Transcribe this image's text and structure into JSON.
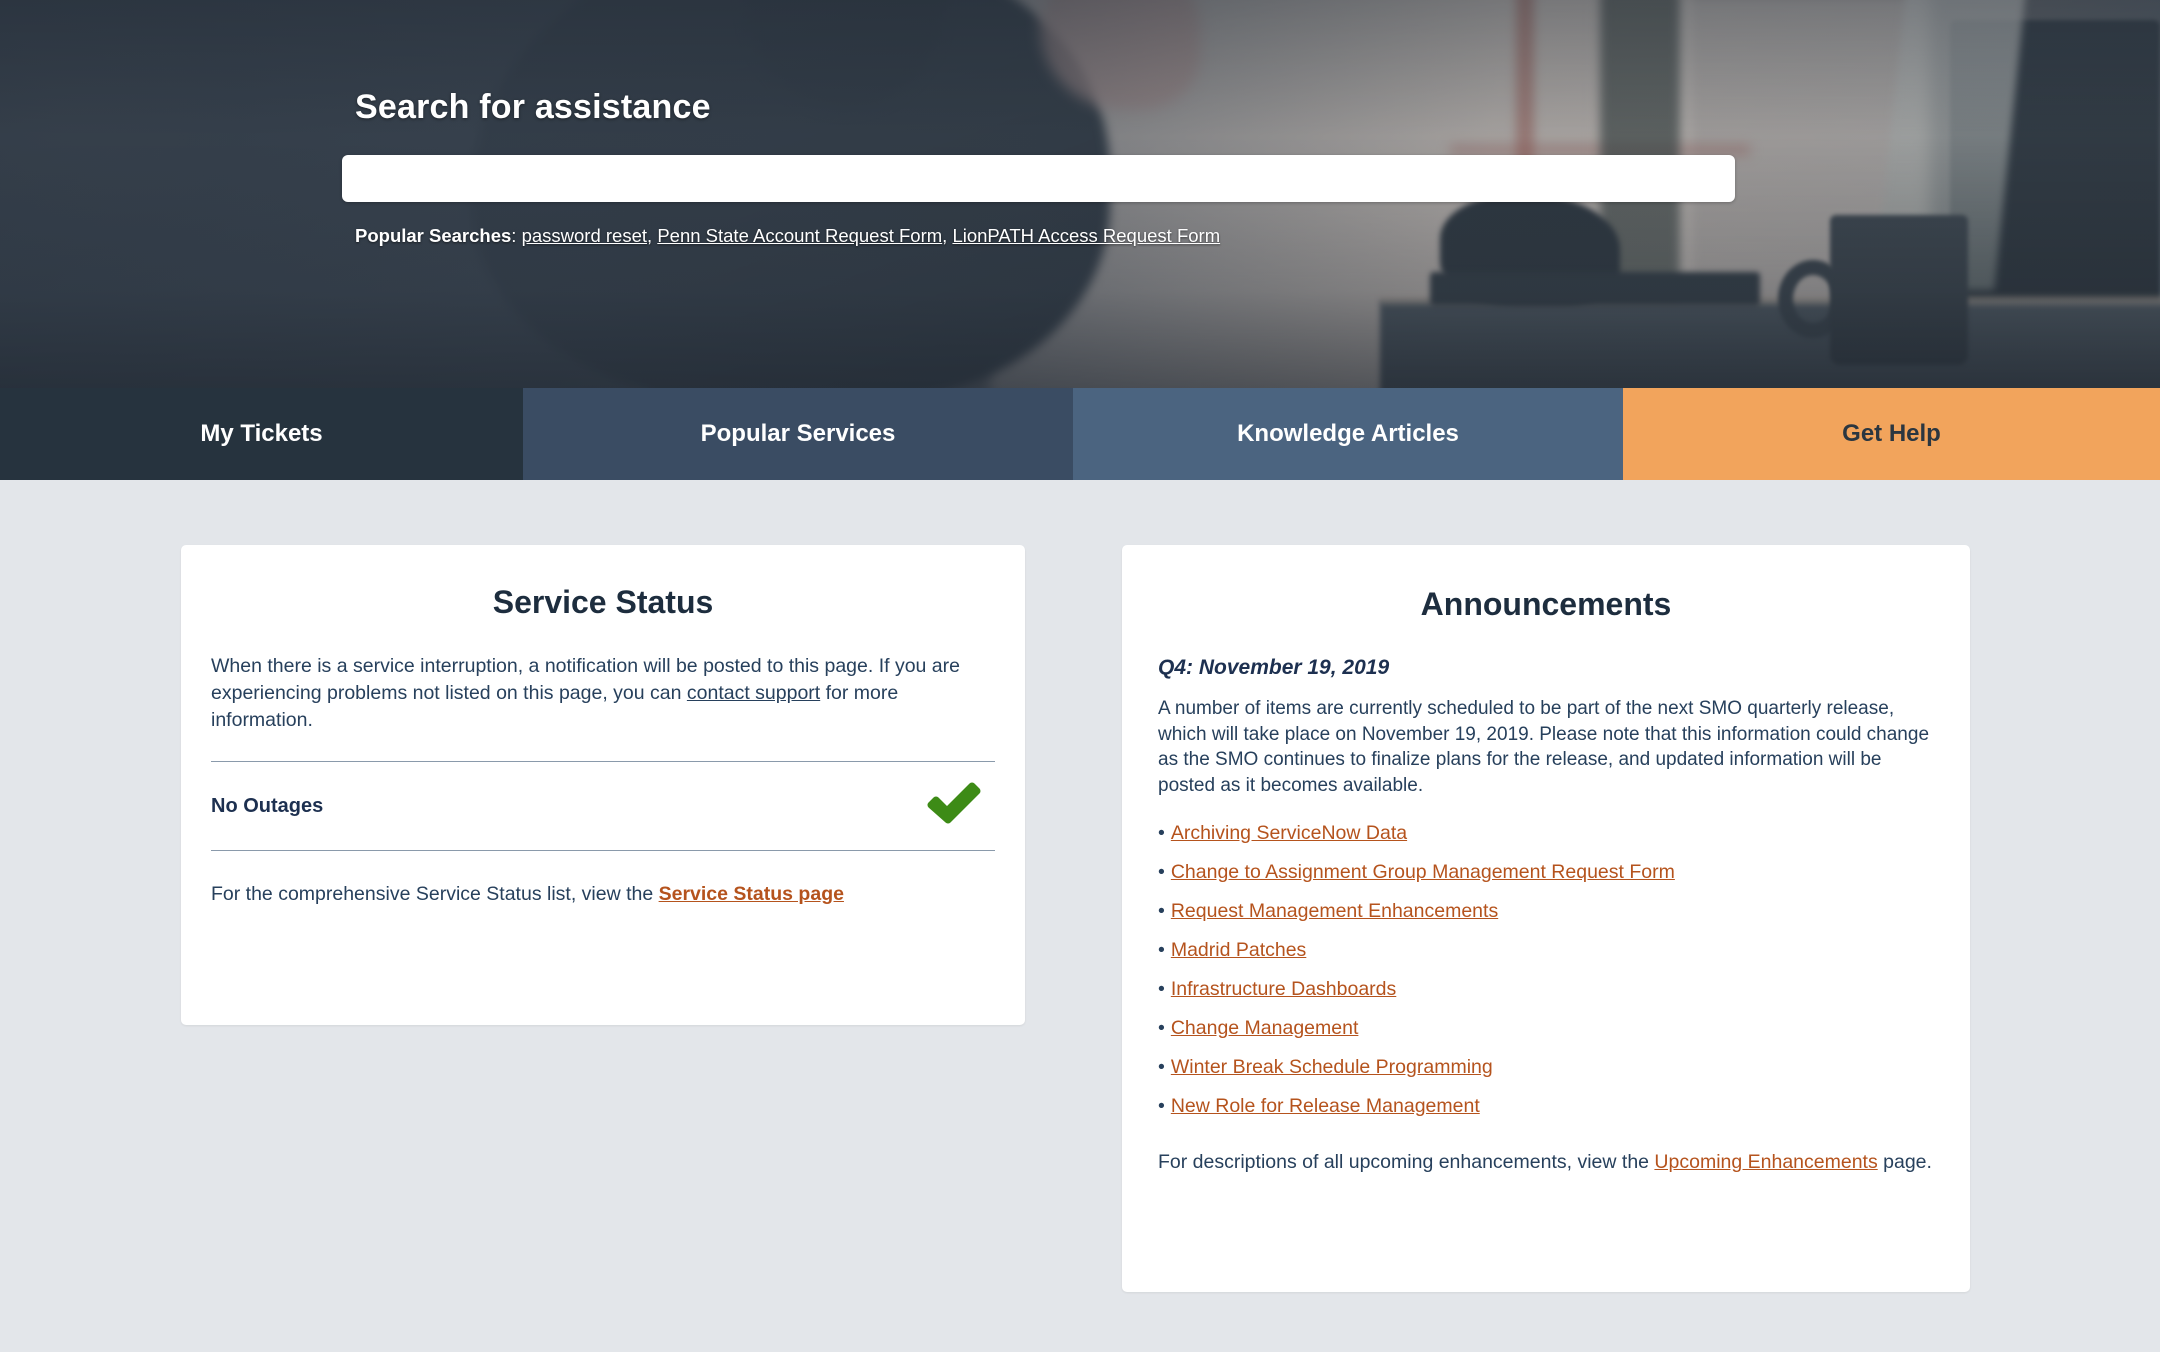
{
  "hero": {
    "title": "Search for assistance",
    "search": {
      "value": "",
      "placeholder": ""
    },
    "popular_label": "Popular Searches",
    "popular_separator": ": ",
    "popular_links": [
      "password reset",
      "Penn State Account Request Form",
      "LionPATH Access Request Form"
    ]
  },
  "nav": {
    "tabs": [
      {
        "label": "My Tickets",
        "bg": "#26333e",
        "fg": "#ffffff"
      },
      {
        "label": "Popular Services",
        "bg": "#3a4c63",
        "fg": "#ffffff"
      },
      {
        "label": "Knowledge Articles",
        "bg": "#4b6480",
        "fg": "#ffffff"
      },
      {
        "label": "Get Help",
        "bg": "#f2a45c",
        "fg": "#2b3640"
      }
    ]
  },
  "service_status": {
    "title": "Service Status",
    "intro_part1": "When there is a service interruption, a notification will be posted to this page. If you are experiencing problems not listed on this page, you can ",
    "intro_link": "contact support",
    "intro_part2": " for more information.",
    "outage_label": "No Outages",
    "outage_icon": "green-check-icon",
    "footer_part1": "For the comprehensive Service Status list, view the ",
    "footer_link": "Service Status page"
  },
  "announcements": {
    "title": "Announcements",
    "date": "Q4: November 19, 2019",
    "intro": "A number of items are currently scheduled to be part of the next SMO quarterly release, which will take place on November 19, 2019. Please note that this information could change as the SMO continues to finalize plans for the release, and updated information will be posted as it becomes available.",
    "bullet_char": "•",
    "items": [
      "Archiving ServiceNow Data",
      "Change to Assignment Group Management Request Form",
      "Request Management Enhancements",
      "Madrid Patches",
      "Infrastructure Dashboards",
      "Change Management",
      "Winter Break Schedule Programming",
      "New Role for Release Management"
    ],
    "footer_part1": "For descriptions of all upcoming enhancements, view the ",
    "footer_link": "Upcoming Enhancements",
    "footer_part2": " page."
  },
  "colors": {
    "page_background": "#e3e6ea",
    "card_background": "#ffffff",
    "link_orange": "#b5531d",
    "text_blue": "#27405c",
    "heading_navy": "#1d2d3e",
    "check_green": "#3d8b16",
    "accent_orange": "#f2a45c"
  }
}
